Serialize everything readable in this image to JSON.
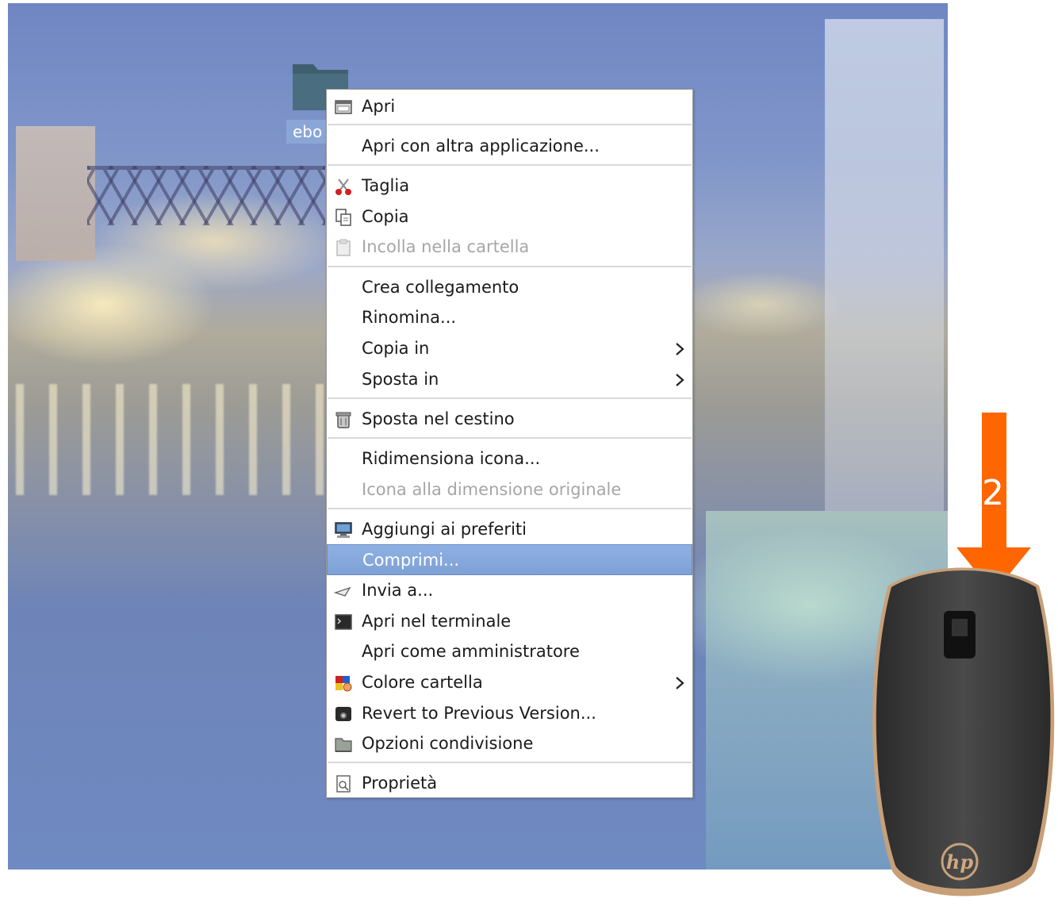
{
  "desktop": {
    "folder_label": "ebo"
  },
  "context_menu": {
    "items": [
      {
        "label": "Apri",
        "icon": "open-window-icon",
        "enabled": true
      },
      {
        "label": "Apri con altra applicazione...",
        "icon": "",
        "enabled": true
      },
      {
        "label": "Taglia",
        "icon": "scissors-icon",
        "enabled": true
      },
      {
        "label": "Copia",
        "icon": "copy-icon",
        "enabled": true
      },
      {
        "label": "Incolla nella cartella",
        "icon": "paste-icon",
        "enabled": false
      },
      {
        "label": "Crea collegamento",
        "icon": "",
        "enabled": true
      },
      {
        "label": "Rinomina...",
        "icon": "",
        "enabled": true
      },
      {
        "label": "Copia in",
        "icon": "",
        "enabled": true,
        "submenu": true
      },
      {
        "label": "Sposta in",
        "icon": "",
        "enabled": true,
        "submenu": true
      },
      {
        "label": "Sposta nel cestino",
        "icon": "trash-icon",
        "enabled": true
      },
      {
        "label": "Ridimensiona icona...",
        "icon": "",
        "enabled": true
      },
      {
        "label": "Icona alla dimensione originale",
        "icon": "",
        "enabled": false
      },
      {
        "label": "Aggiungi ai preferiti",
        "icon": "computer-icon",
        "enabled": true
      },
      {
        "label": "Comprimi...",
        "icon": "",
        "enabled": true,
        "highlighted": true
      },
      {
        "label": "Invia a...",
        "icon": "send-icon",
        "enabled": true
      },
      {
        "label": "Apri nel terminale",
        "icon": "terminal-icon",
        "enabled": true
      },
      {
        "label": "Apri come amministratore",
        "icon": "",
        "enabled": true
      },
      {
        "label": "Colore cartella",
        "icon": "color-palette-icon",
        "enabled": true,
        "submenu": true
      },
      {
        "label": "Revert to Previous Version...",
        "icon": "camera-icon",
        "enabled": true
      },
      {
        "label": "Opzioni condivisione",
        "icon": "share-folder-icon",
        "enabled": true
      },
      {
        "label": "Proprietà",
        "icon": "properties-icon",
        "enabled": true
      }
    ]
  },
  "annotation": {
    "step_number": "2",
    "arrow_color": "#ff6600",
    "mouse_brand": "hp"
  },
  "colors": {
    "highlight": "#7ea1d6",
    "disabled_text": "#a6a6a6",
    "menu_text": "#1a1a1a"
  }
}
